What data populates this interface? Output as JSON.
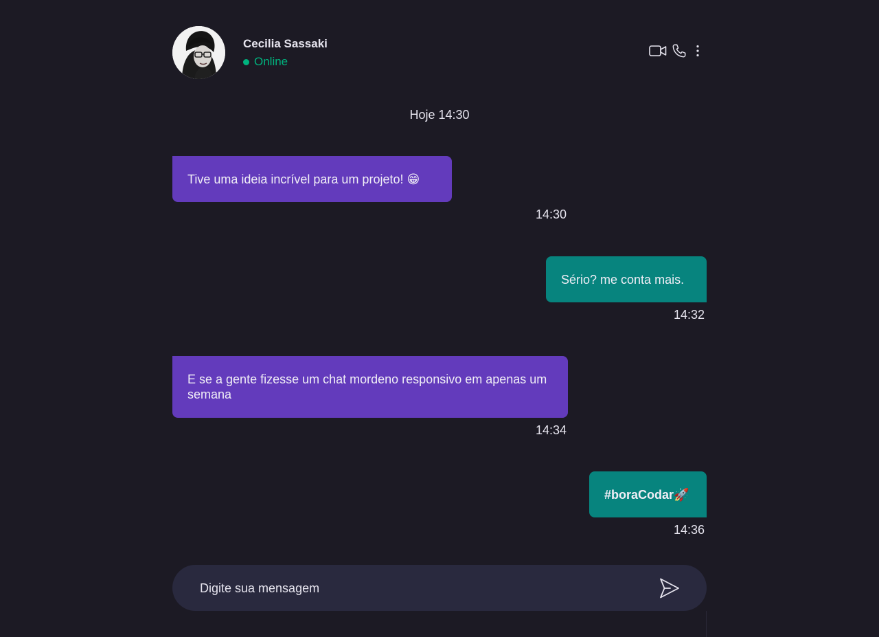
{
  "contact": {
    "name": "Cecilia Sassaki",
    "status": "Online",
    "status_color": "#00b37e",
    "avatar_icon": "person-avatar"
  },
  "header_actions": {
    "video_icon": "video-camera-icon",
    "phone_icon": "phone-icon",
    "more_icon": "more-vertical-icon"
  },
  "day_divider": "Hoje 14:30",
  "messages": [
    {
      "direction": "received",
      "text": "Tive uma ideia incrível para um projeto! 😁",
      "time": "14:30"
    },
    {
      "direction": "sent",
      "text": "Sério? me conta mais.",
      "time": "14:32"
    },
    {
      "direction": "received",
      "text": "E se a gente fizesse um chat mordeno responsivo em apenas um semana",
      "time": "14:34"
    },
    {
      "direction": "sent",
      "text": "#boraCodar🚀",
      "time": "14:36"
    }
  ],
  "composer": {
    "placeholder": "Digite sua mensagem",
    "send_icon": "send-icon"
  },
  "colors": {
    "background": "#1c1a24",
    "received_bubble": "#633bbc",
    "sent_bubble": "#07847e",
    "composer": "#29293e"
  }
}
